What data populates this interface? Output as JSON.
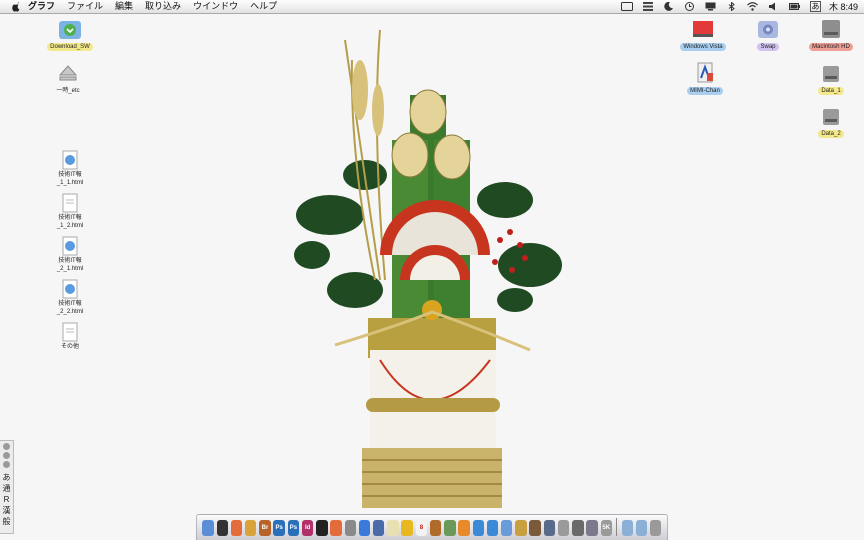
{
  "menubar": {
    "items": [
      "グラフ",
      "ファイル",
      "編集",
      "取り込み",
      "ウインドウ",
      "ヘルプ"
    ],
    "clock": "木 8:49",
    "input_indicator": "あ"
  },
  "desktop": {
    "download": "Download_SW",
    "eject": "一時_etc",
    "windows_vista": "Windows Vista",
    "swap": "Swap",
    "macintosh_hd": "Macintosh HD",
    "mimi_chan": "MIMI-Chan",
    "data1": "Data_1",
    "data2": "Data_2",
    "files": [
      "技術IT報\n_1_1.html",
      "技術IT報\n_1_2.html",
      "技術IT報\n_2_1.html",
      "技術IT報\n_2_2.html",
      "その他"
    ]
  },
  "input_palette": [
    "あ",
    "通",
    "R",
    "漢",
    "般"
  ],
  "dock": {
    "apps": [
      {
        "icon": "finder-icon",
        "color": "#5a8fd8",
        "text": ""
      },
      {
        "icon": "dashboard-icon",
        "color": "#333333",
        "text": ""
      },
      {
        "icon": "sketch-icon",
        "color": "#e46b3a",
        "text": ""
      },
      {
        "icon": "safari-icon",
        "color": "#d9a23a",
        "text": ""
      },
      {
        "icon": "bridge-icon",
        "color": "#b8632a",
        "text": "Br"
      },
      {
        "icon": "photoshop-icon",
        "color": "#2a6fba",
        "text": "Ps"
      },
      {
        "icon": "photoshop2-icon",
        "color": "#2a6fba",
        "text": "Ps"
      },
      {
        "icon": "indesign-icon",
        "color": "#b0306a",
        "text": "Id"
      },
      {
        "icon": "terminal-icon",
        "color": "#222222",
        "text": ""
      },
      {
        "icon": "ical-icon",
        "color": "#e46b3a",
        "text": ""
      },
      {
        "icon": "chat-icon",
        "color": "#8a8a8a",
        "text": ""
      },
      {
        "icon": "browser-icon",
        "color": "#3a7ad8",
        "text": ""
      },
      {
        "icon": "mail-icon",
        "color": "#4a6aa8",
        "text": ""
      },
      {
        "icon": "notes-icon",
        "color": "#e8e0b0",
        "text": ""
      },
      {
        "icon": "star-icon",
        "color": "#e8b820",
        "text": ""
      },
      {
        "icon": "calendar-icon",
        "color": "#f2f2f2",
        "text": "8"
      },
      {
        "icon": "address-book-icon",
        "color": "#b06a2a",
        "text": ""
      },
      {
        "icon": "image-icon",
        "color": "#6a9a5a",
        "text": ""
      },
      {
        "icon": "vlc-icon",
        "color": "#e88a2a",
        "text": ""
      },
      {
        "icon": "network-icon",
        "color": "#3a8ad8",
        "text": ""
      },
      {
        "icon": "download-icon",
        "color": "#3a8ad8",
        "text": ""
      },
      {
        "icon": "itunes-icon",
        "color": "#6a9ad8",
        "text": ""
      },
      {
        "icon": "preview-icon",
        "color": "#c8a040",
        "text": ""
      },
      {
        "icon": "photo-icon",
        "color": "#7a5a3a",
        "text": ""
      },
      {
        "icon": "grid-icon",
        "color": "#5a6a8a",
        "text": ""
      },
      {
        "icon": "utility-icon",
        "color": "#9a9a9a",
        "text": ""
      },
      {
        "icon": "screenshot-icon",
        "color": "#6a6a6a",
        "text": ""
      },
      {
        "icon": "monitor-icon",
        "color": "#7a7a8a",
        "text": ""
      },
      {
        "icon": "counter-icon",
        "color": "#9a9a9a",
        "text": "5K"
      }
    ],
    "stacks": [
      {
        "icon": "folder-icon",
        "color": "#8ab0d8"
      },
      {
        "icon": "documents-icon",
        "color": "#8ab0d8"
      },
      {
        "icon": "trash-icon",
        "color": "#9a9a9a"
      }
    ]
  }
}
